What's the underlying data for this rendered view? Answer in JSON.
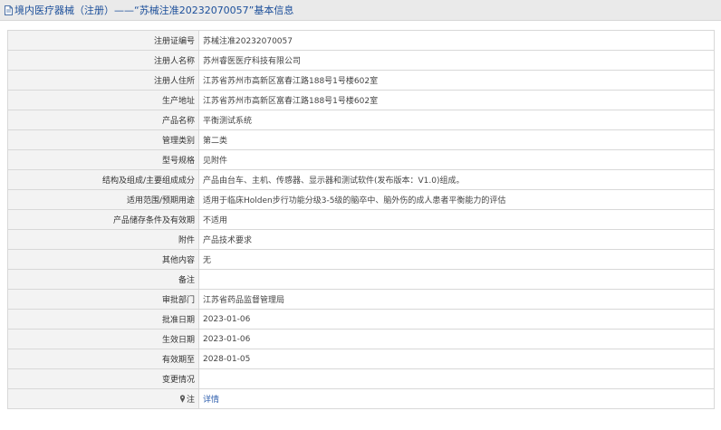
{
  "header": {
    "title": "境内医疗器械（注册）——“苏械注准20232070057”基本信息"
  },
  "rows": [
    {
      "label": "注册证编号",
      "value": "苏械注准20232070057"
    },
    {
      "label": "注册人名称",
      "value": "苏州睿医医疗科技有限公司"
    },
    {
      "label": "注册人住所",
      "value": "江苏省苏州市高新区富春江路188号1号楼602室"
    },
    {
      "label": "生产地址",
      "value": "江苏省苏州市高新区富春江路188号1号楼602室"
    },
    {
      "label": "产品名称",
      "value": "平衡测试系统"
    },
    {
      "label": "管理类别",
      "value": "第二类"
    },
    {
      "label": "型号规格",
      "value": "见附件"
    },
    {
      "label": "结构及组成/主要组成成分",
      "value": "产品由台车、主机、传感器、显示器和测试软件(发布版本：V1.0)组成。"
    },
    {
      "label": "适用范围/预期用途",
      "value": "适用于临床Holden步行功能分级3-5级的脑卒中、脑外伤的成人患者平衡能力的评估"
    },
    {
      "label": "产品储存条件及有效期",
      "value": "不适用"
    },
    {
      "label": "附件",
      "value": "产品技术要求"
    },
    {
      "label": "其他内容",
      "value": "无"
    },
    {
      "label": "备注",
      "value": ""
    },
    {
      "label": "审批部门",
      "value": "江苏省药品监督管理局"
    },
    {
      "label": "批准日期",
      "value": "2023-01-06"
    },
    {
      "label": "生效日期",
      "value": "2023-01-06"
    },
    {
      "label": "有效期至",
      "value": "2028-01-05"
    },
    {
      "label": "变更情况",
      "value": ""
    }
  ],
  "note_row": {
    "icon": "pin-icon",
    "label": "注",
    "link_text": "详情"
  }
}
